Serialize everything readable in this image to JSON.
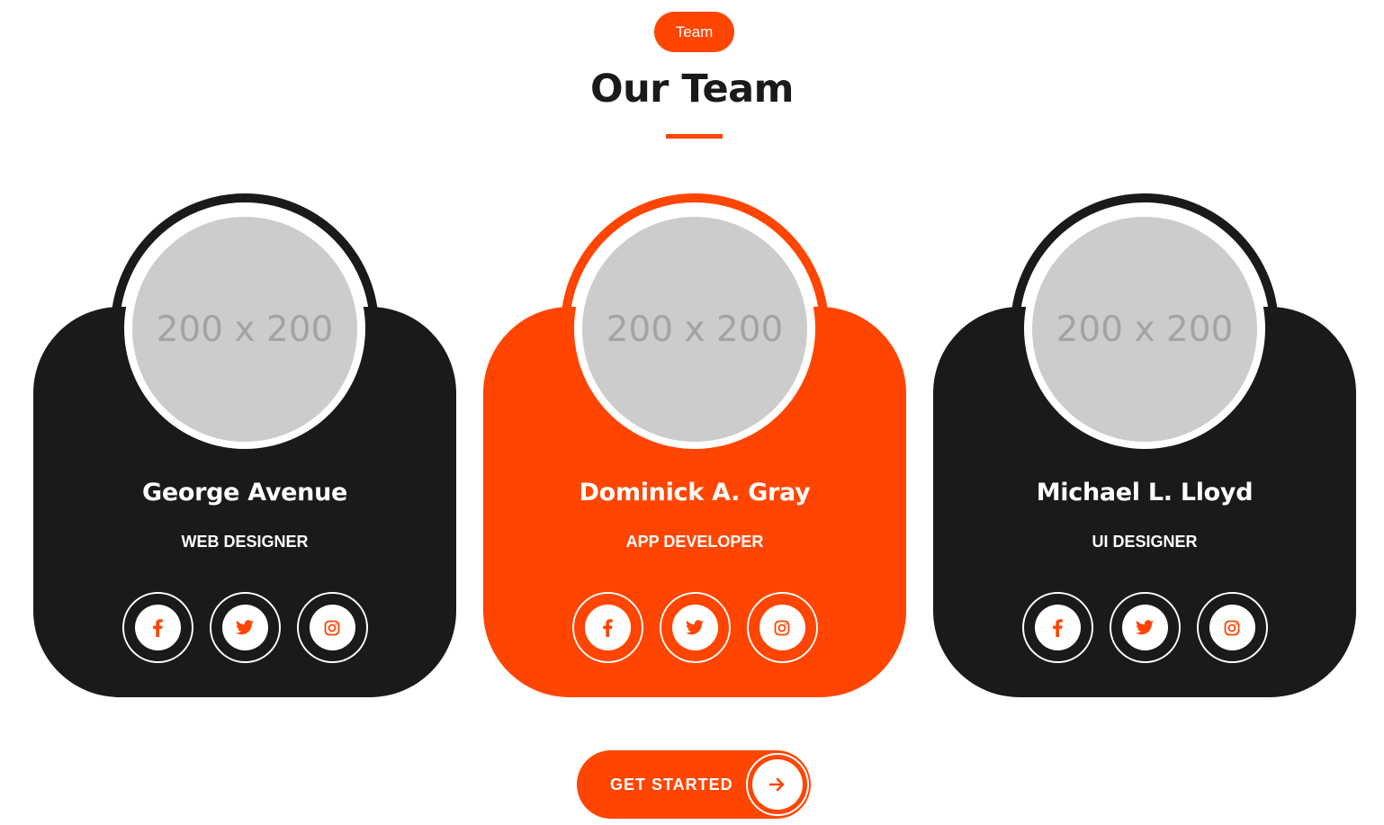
{
  "section": {
    "badge": "Team",
    "title": "Our Team"
  },
  "colors": {
    "accent": "#ff4500",
    "dark": "#1a1a1c",
    "placeholder": "#cccccc"
  },
  "members": [
    {
      "name": "George Avenue",
      "role": "WEB DESIGNER",
      "avatar_text": "200 x 200"
    },
    {
      "name": "Dominick A. Gray",
      "role": "APP DEVELOPER",
      "avatar_text": "200 x 200"
    },
    {
      "name": "Michael L. Lloyd",
      "role": "UI DESIGNER",
      "avatar_text": "200 x 200"
    }
  ],
  "socials": [
    "facebook-icon",
    "twitter-icon",
    "instagram-icon"
  ],
  "cta": {
    "label": "GET STARTED",
    "icon": "arrow-right-icon"
  }
}
